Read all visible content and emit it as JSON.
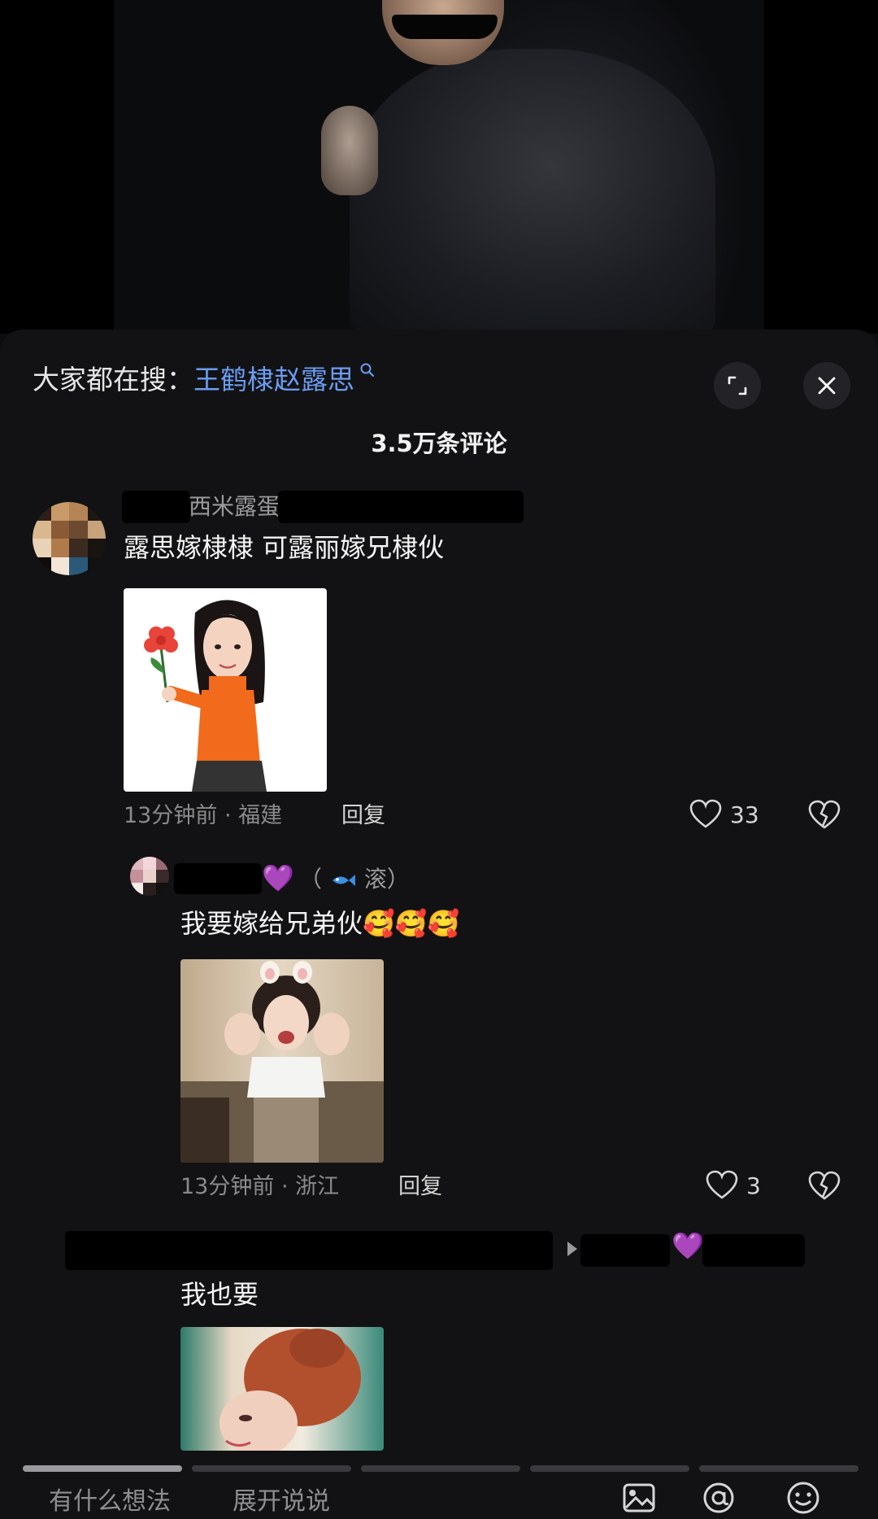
{
  "search_prompt": {
    "prefix": "大家都在搜：",
    "keyword": "王鹤棣赵露思"
  },
  "comment_count": "3.5万条评论",
  "comments": [
    {
      "username_visible": "西米露蛋",
      "text": "露思嫁棣棣 可露丽嫁兄棣伙",
      "time": "13分钟前",
      "location": "福建",
      "reply_label": "回复",
      "likes": "33"
    }
  ],
  "replies": [
    {
      "emoji_badge": "💜",
      "fan_label": "（",
      "fan_label_text": "滚）",
      "text": "我要嫁给兄弟伙",
      "emoji": "🥰🥰🥰",
      "time": "13分钟前",
      "location": "浙江",
      "reply_label": "回复",
      "likes": "3"
    },
    {
      "emoji_badge": "💜",
      "text": "我也要"
    }
  ],
  "bottom_bar": {
    "placeholder": "有什么想法",
    "expand_label": "展开说说"
  },
  "colors": {
    "keyword_blue": "#6b9cf0",
    "sheet_bg": "#121214",
    "badge_purple": "#9b5de5"
  }
}
